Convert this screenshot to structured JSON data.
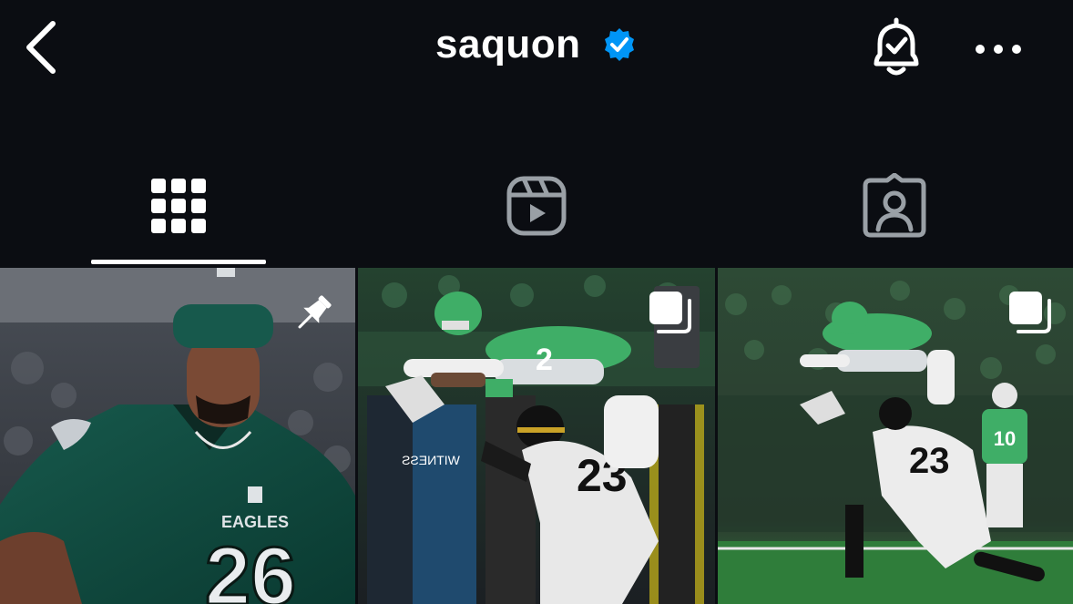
{
  "header": {
    "username": "saquon",
    "back_icon": "chevron-left-icon",
    "verified_icon": "verified-badge-icon",
    "verified_color": "#0095f6",
    "bell_icon": "bell-check-icon",
    "more_icon": "more-horizontal-icon"
  },
  "tabs": [
    {
      "name": "posts",
      "icon": "grid-icon",
      "selected": true
    },
    {
      "name": "reels",
      "icon": "reels-icon",
      "selected": false
    },
    {
      "name": "tagged",
      "icon": "tagged-person-icon",
      "selected": false
    }
  ],
  "posts": [
    {
      "type": "pinned",
      "badge_icon": "pin-icon",
      "jersey_number": "26",
      "jersey_wordmark": "EAGLES"
    },
    {
      "type": "carousel",
      "badge_icon": "carousel-icon",
      "overlay_text": "WITNESS",
      "jersey_number": "23"
    },
    {
      "type": "carousel",
      "badge_icon": "carousel-icon",
      "jersey_number": "23",
      "background_jersey_number": "10"
    }
  ],
  "colors": {
    "background": "#0b0d12",
    "eagles_green": "#0d4a3f",
    "kelly_green": "#3a9a5a",
    "field_green": "#2f7d3a",
    "tab_inactive": "#9aa0a6"
  }
}
